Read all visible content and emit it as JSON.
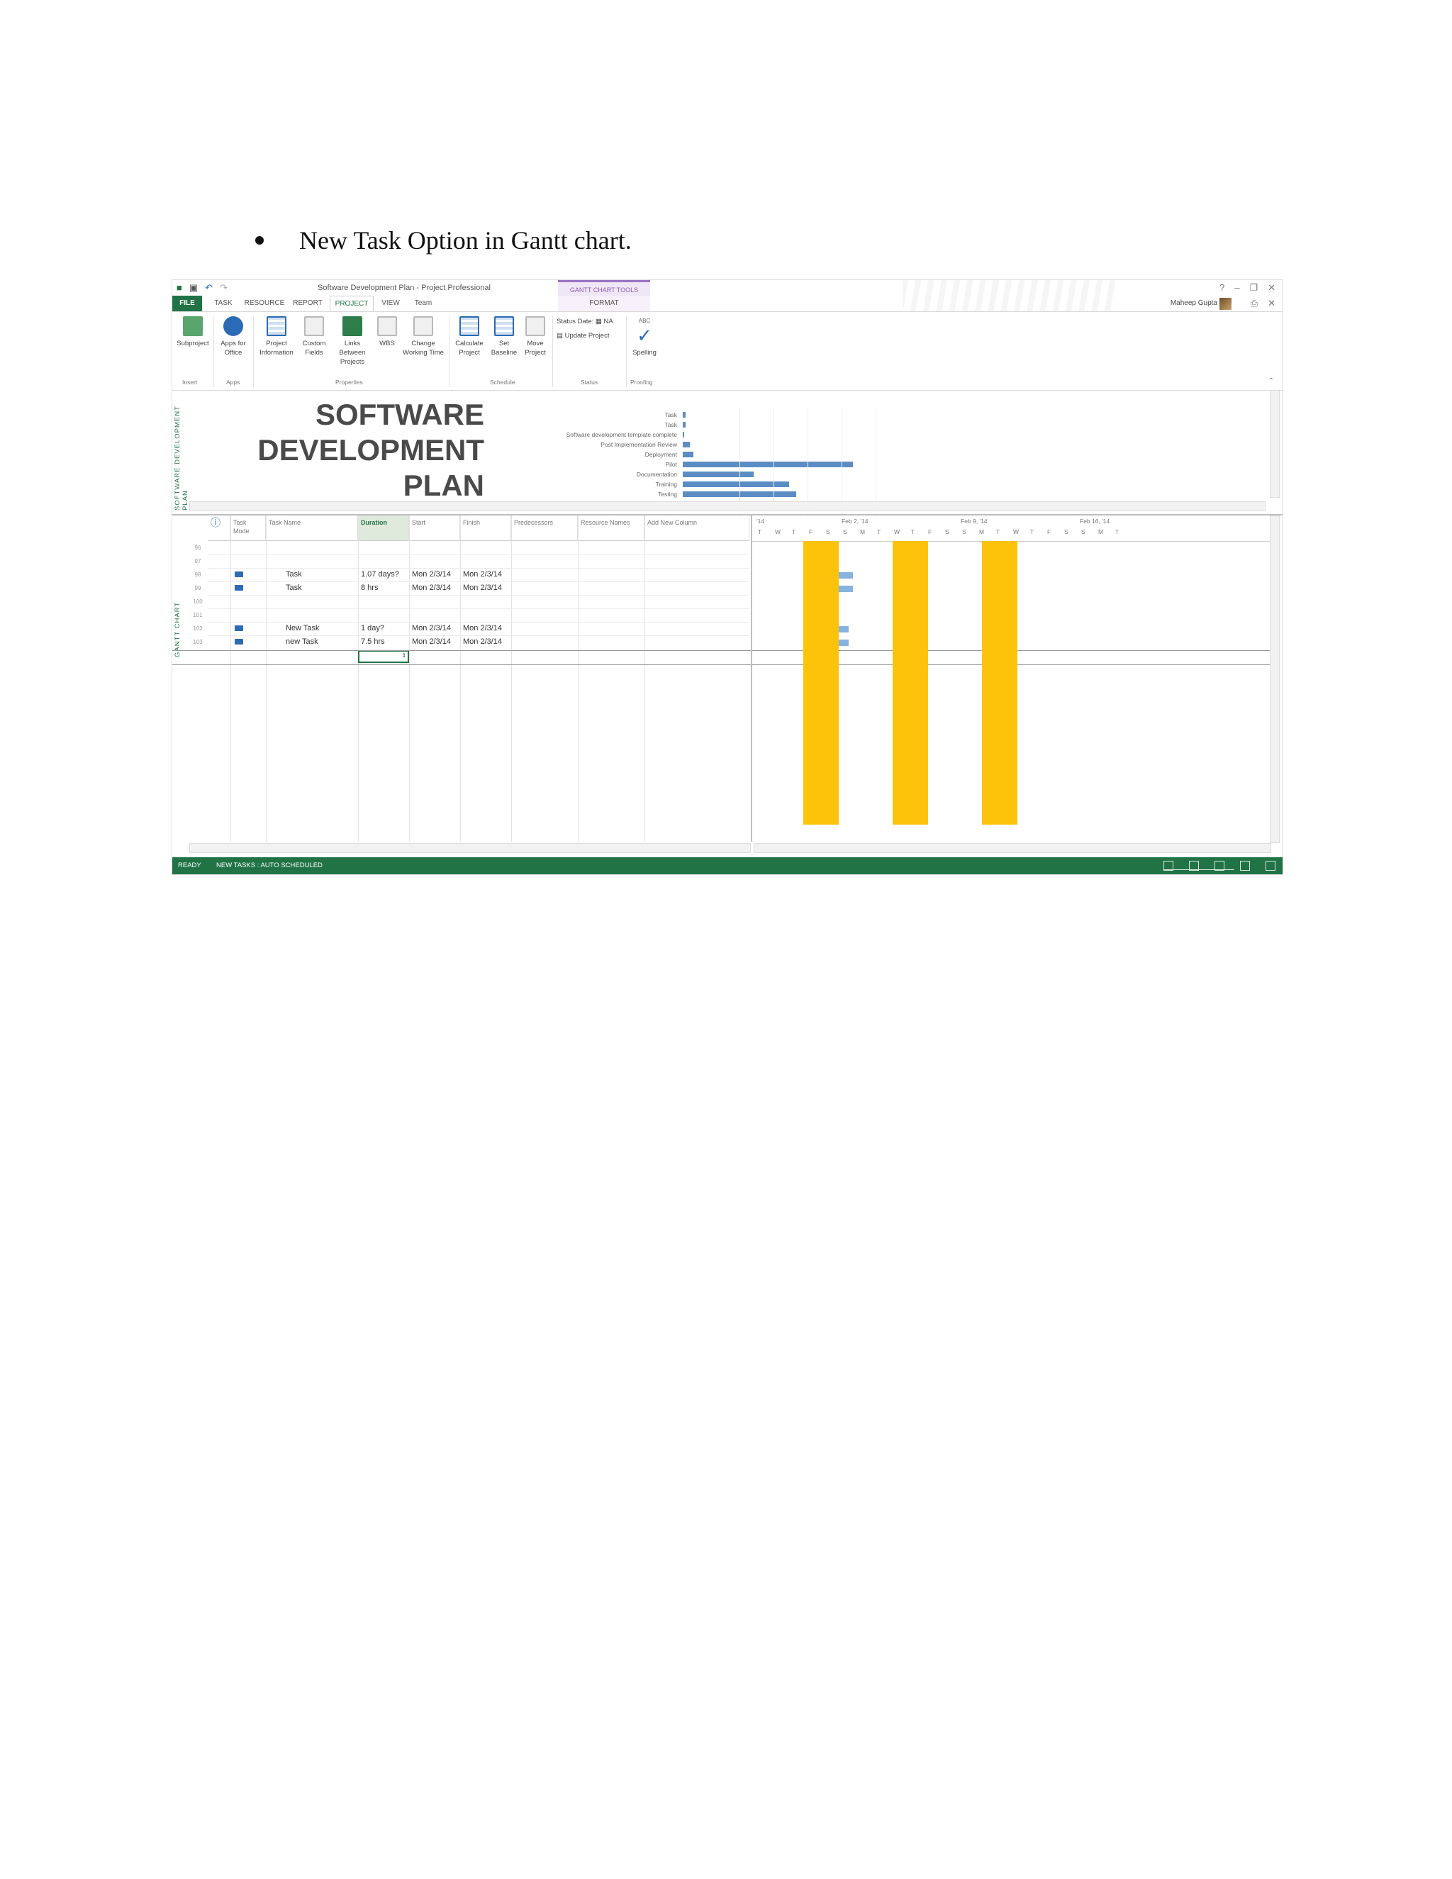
{
  "doc": {
    "bullet_text": "New Task Option in Gantt chart."
  },
  "window": {
    "title": "Software Development Plan - Project Professional",
    "context_group": "GANTT CHART TOOLS",
    "user": "Maheep Gupta"
  },
  "tabs": [
    "FILE",
    "TASK",
    "RESOURCE",
    "REPORT",
    "PROJECT",
    "VIEW",
    "Team",
    "FORMAT"
  ],
  "active_tab": "PROJECT",
  "ribbon": {
    "buttons": {
      "subproject": "Subproject",
      "apps_for_office": "Apps for Office",
      "project_information": "Project Information",
      "custom_fields": "Custom Fields",
      "links_between_projects": "Links Between Projects",
      "wbs": "WBS",
      "change_working_time": "Change Working Time",
      "calculate_project": "Calculate Project",
      "set_baseline": "Set Baseline",
      "move_project": "Move Project",
      "status_date": "Status Date:",
      "status_date_value": "NA",
      "update_project": "Update Project",
      "spelling": "Spelling",
      "abc": "ABC"
    },
    "groups": {
      "insert": "Insert",
      "apps": "Apps",
      "properties": "Properties",
      "schedule": "Schedule",
      "status": "Status",
      "proofing": "Proofing"
    }
  },
  "timeline": {
    "side_label": "SOFTWARE DEVELOPMENT PLAN",
    "title_lines": [
      "SOFTWARE",
      "DEVELOPMENT",
      "PLAN"
    ],
    "tasks": [
      {
        "label": "Task",
        "bar": 0.005
      },
      {
        "label": "Task",
        "bar": 0.005
      },
      {
        "label": "Software development template complete",
        "bar": 0
      },
      {
        "label": "Post Implementation Review",
        "bar": 0.02
      },
      {
        "label": "Deployment",
        "bar": 0.03
      },
      {
        "label": "Pilot",
        "bar": 0.48
      },
      {
        "label": "Documentation",
        "bar": 0.2
      },
      {
        "label": "Training",
        "bar": 0.3
      },
      {
        "label": "Testing",
        "bar": 0.32
      }
    ]
  },
  "gantt": {
    "side_label": "GANTT CHART",
    "columns": [
      "Task Mode",
      "Task Name",
      "Duration",
      "Start",
      "Finish",
      "Predecessors",
      "Resource Names",
      "Add New Column"
    ],
    "rows": [
      {
        "id": "96",
        "mode": false,
        "name": "",
        "duration": "",
        "start": "",
        "finish": ""
      },
      {
        "id": "97",
        "mode": false,
        "name": "",
        "duration": "",
        "start": "",
        "finish": ""
      },
      {
        "id": "98",
        "mode": true,
        "name": "Task",
        "duration": "1.07 days?",
        "start": "Mon 2/3/14",
        "finish": "Mon 2/3/14"
      },
      {
        "id": "99",
        "mode": true,
        "name": "Task",
        "duration": "8 hrs",
        "start": "Mon 2/3/14",
        "finish": "Mon 2/3/14"
      },
      {
        "id": "100",
        "mode": false,
        "name": "",
        "duration": "",
        "start": "",
        "finish": ""
      },
      {
        "id": "101",
        "mode": false,
        "name": "",
        "duration": "",
        "start": "",
        "finish": ""
      },
      {
        "id": "102",
        "mode": true,
        "name": "New Task",
        "duration": "1 day?",
        "start": "Mon 2/3/14",
        "finish": "Mon 2/3/14"
      },
      {
        "id": "103",
        "mode": true,
        "name": "new Task",
        "duration": "7.5 hrs",
        "start": "Mon 2/3/14",
        "finish": "Mon 2/3/14"
      }
    ],
    "timescale": {
      "weeks": [
        "'14",
        "Feb 2, '14",
        "Feb 9, '14",
        "Feb 16, '14"
      ],
      "days": [
        "T",
        "W",
        "T",
        "F",
        "S",
        "S",
        "M",
        "T",
        "W",
        "T",
        "F",
        "S",
        "S",
        "M",
        "T",
        "W",
        "T",
        "F",
        "S",
        "S",
        "M",
        "T"
      ]
    }
  },
  "status_bar": {
    "ready": "READY",
    "new_tasks": "NEW TASKS : AUTO SCHEDULED"
  },
  "colors": {
    "accent": "#217346",
    "weekend": "#fdc20a",
    "bar": "#5b8dc4"
  }
}
